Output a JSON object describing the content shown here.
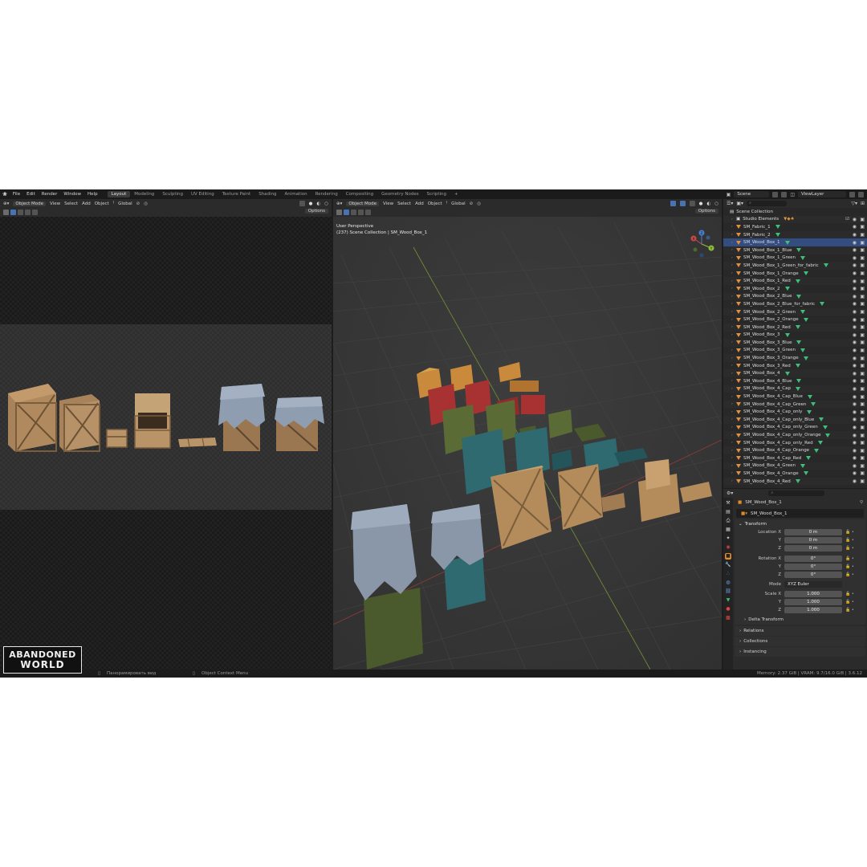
{
  "menu": [
    "File",
    "Edit",
    "Render",
    "Window",
    "Help"
  ],
  "workspaces": [
    {
      "label": "Layout",
      "active": true
    },
    {
      "label": "Modeling"
    },
    {
      "label": "Sculpting"
    },
    {
      "label": "UV Editing"
    },
    {
      "label": "Texture Paint"
    },
    {
      "label": "Shading"
    },
    {
      "label": "Animation"
    },
    {
      "label": "Rendering"
    },
    {
      "label": "Compositing"
    },
    {
      "label": "Geometry Nodes"
    },
    {
      "label": "Scripting"
    }
  ],
  "add_tab": "+",
  "scene": "Scene",
  "view_layer": "ViewLayer",
  "viewport_header": {
    "mode": "Object Mode",
    "view": "View",
    "select": "Select",
    "add": "Add",
    "object": "Object",
    "orientation": "Global",
    "options": "Options"
  },
  "center_viewport": {
    "perspective": "User Perspective",
    "collection": "(237) Scene Collection | SM_Wood_Box_1",
    "accent_x": "#c94a4a",
    "accent_y": "#8cbf3a",
    "accent_z": "#4a7fd6"
  },
  "outliner": {
    "root": "Scene Collection",
    "rows": [
      {
        "name": "Studio Elements",
        "kind": "collection"
      },
      {
        "name": "SM_Fabric_1"
      },
      {
        "name": "SM_Fabric_2"
      },
      {
        "name": "SM_Wood_Box_1",
        "selected": true
      },
      {
        "name": "SM_Wood_Box_1_Blue"
      },
      {
        "name": "SM_Wood_Box_1_Green"
      },
      {
        "name": "SM_Wood_Box_1_Green_for_fabric"
      },
      {
        "name": "SM_Wood_Box_1_Orange"
      },
      {
        "name": "SM_Wood_Box_1_Red"
      },
      {
        "name": "SM_Wood_Box_2"
      },
      {
        "name": "SM_Wood_Box_2_Blue"
      },
      {
        "name": "SM_Wood_Box_2_Blue_for_fabric"
      },
      {
        "name": "SM_Wood_Box_2_Green"
      },
      {
        "name": "SM_Wood_Box_2_Orange"
      },
      {
        "name": "SM_Wood_Box_2_Red"
      },
      {
        "name": "SM_Wood_Box_3"
      },
      {
        "name": "SM_Wood_Box_3_Blue"
      },
      {
        "name": "SM_Wood_Box_3_Green"
      },
      {
        "name": "SM_Wood_Box_3_Orange"
      },
      {
        "name": "SM_Wood_Box_3_Red"
      },
      {
        "name": "SM_Wood_Box_4"
      },
      {
        "name": "SM_Wood_Box_4_Blue"
      },
      {
        "name": "SM_Wood_Box_4_Cap"
      },
      {
        "name": "SM_Wood_Box_4_Cap_Blue"
      },
      {
        "name": "SM_Wood_Box_4_Cap_Green"
      },
      {
        "name": "SM_Wood_Box_4_Cap_only"
      },
      {
        "name": "SM_Wood_Box_4_Cap_only_Blue"
      },
      {
        "name": "SM_Wood_Box_4_Cap_only_Green"
      },
      {
        "name": "SM_Wood_Box_4_Cap_only_Orange"
      },
      {
        "name": "SM_Wood_Box_4_Cap_only_Red"
      },
      {
        "name": "SM_Wood_Box_4_Cap_Orange"
      },
      {
        "name": "SM_Wood_Box_4_Cap_Red"
      },
      {
        "name": "SM_Wood_Box_4_Green"
      },
      {
        "name": "SM_Wood_Box_4_Orange"
      },
      {
        "name": "SM_Wood_Box_4_Red"
      }
    ]
  },
  "properties": {
    "object_name": "SM_Wood_Box_1",
    "data_name": "SM_Wood_Box_1",
    "transform_title": "Transform",
    "location": {
      "label": "Location X",
      "x": "0 m",
      "y": "0 m",
      "z": "0 m"
    },
    "rotation": {
      "label": "Rotation X",
      "x": "0°",
      "y": "0°",
      "z": "0°"
    },
    "mode": {
      "label": "Mode",
      "value": "XYZ Euler"
    },
    "scale": {
      "label": "Scale X",
      "x": "1.000",
      "y": "1.000",
      "z": "1.000"
    },
    "axis_y": "Y",
    "axis_z": "Z",
    "delta_transform": "Delta Transform",
    "relations": "Relations",
    "collections": "Collections",
    "instancing": "Instancing"
  },
  "status": {
    "pan": "Панорамировать вид",
    "context": "Object Context Menu",
    "memory": "Memory: 2.37 GiB | VRAM: 9.7/16.0 GiB | 3.6.12"
  },
  "watermark": {
    "line1": "ABANDONED",
    "line2": "WORLD"
  },
  "icons": {
    "blender": "blender-logo-icon",
    "eye": "eye-icon",
    "camera": "camera-icon",
    "mesh": "mesh-triangle-icon",
    "search": "search-icon"
  },
  "colors": {
    "orange_box": "#c98a3c",
    "red_box": "#a83232",
    "green_box": "#5a6b35",
    "blue_box": "#2e6a70",
    "wood": "#b48c5c",
    "fabric": "#8a97a8"
  }
}
